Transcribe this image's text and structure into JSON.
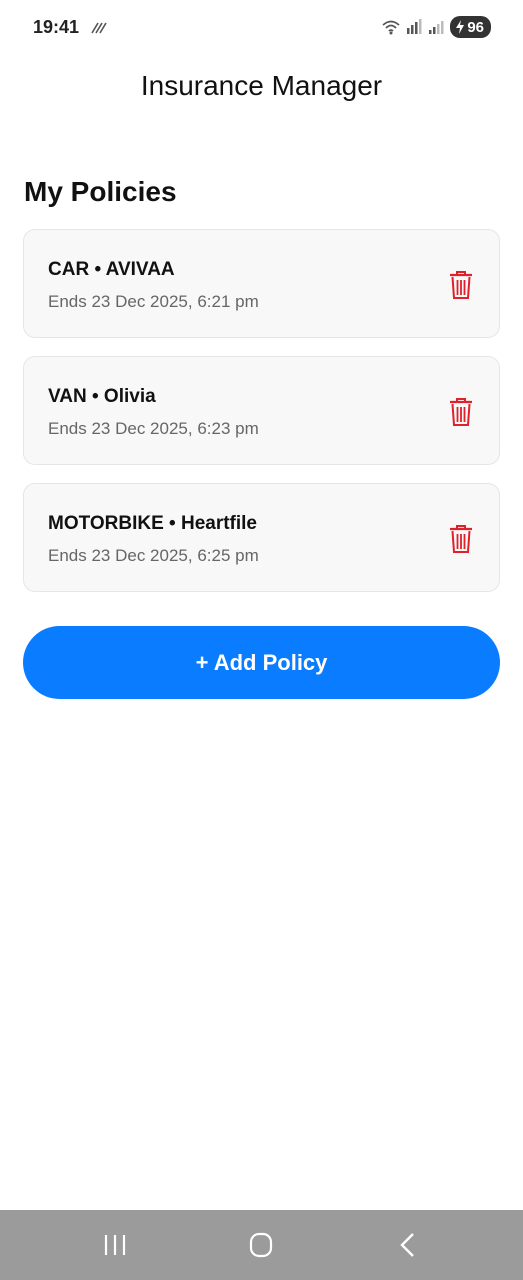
{
  "status_bar": {
    "time": "19:41",
    "battery_level": "96",
    "icons": [
      "mute-icon",
      "wifi-icon",
      "signal-icon",
      "signal-icon",
      "battery-charging-icon"
    ]
  },
  "header": {
    "title": "Insurance Manager"
  },
  "main": {
    "section_title": "My Policies",
    "policies": [
      {
        "label": "CAR • AVIVAA",
        "ends": "Ends 23 Dec 2025, 6:21 pm"
      },
      {
        "label": "VAN • Olivia",
        "ends": "Ends 23 Dec 2025, 6:23 pm"
      },
      {
        "label": "MOTORBIKE • Heartfile",
        "ends": "Ends 23 Dec 2025, 6:25 pm"
      }
    ],
    "add_button_label": "+ Add Policy"
  },
  "colors": {
    "accent": "#0a7cff",
    "delete": "#e0202a",
    "nav_bar": "#9b9b9b"
  }
}
